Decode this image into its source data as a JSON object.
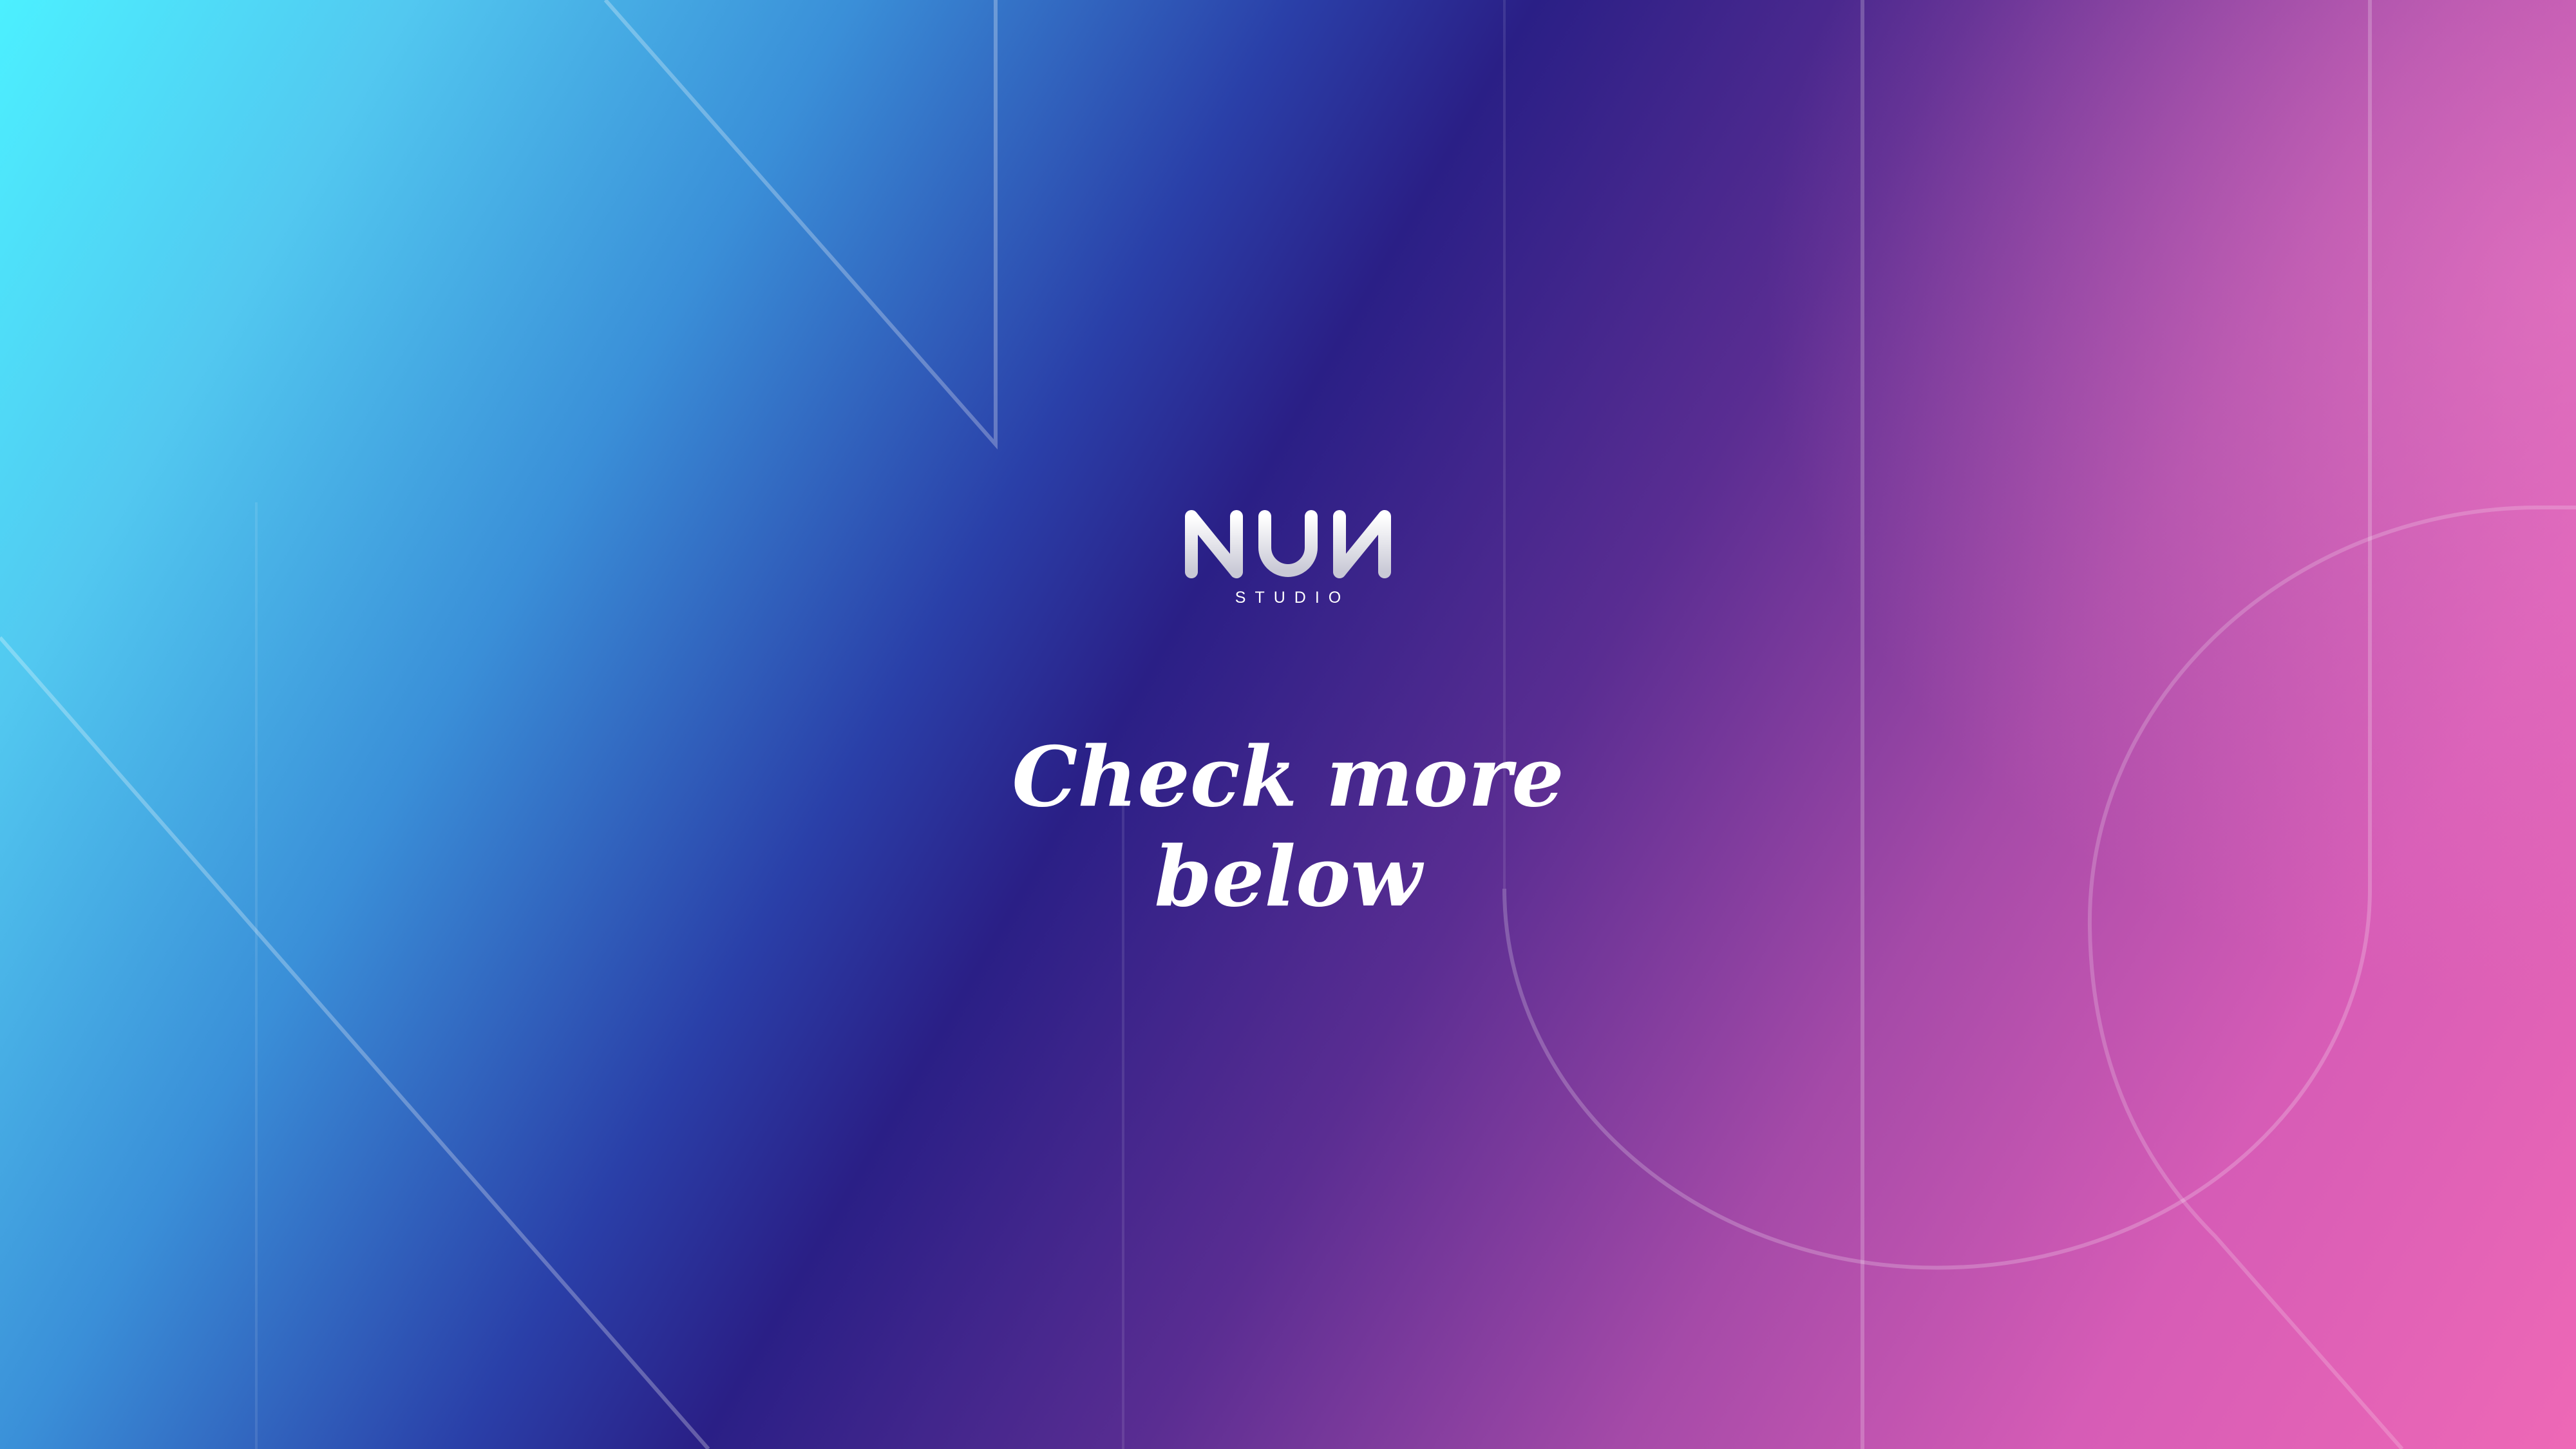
{
  "brand": {
    "logo_text": "NUN",
    "sub_text": "STUDIO"
  },
  "headline": {
    "line1": "Check more",
    "line2": "below"
  },
  "colors": {
    "top_left": "#4cf0ff",
    "center_bottom": "#2a1f86",
    "right": "#ee68b6",
    "text": "#ffffff"
  }
}
